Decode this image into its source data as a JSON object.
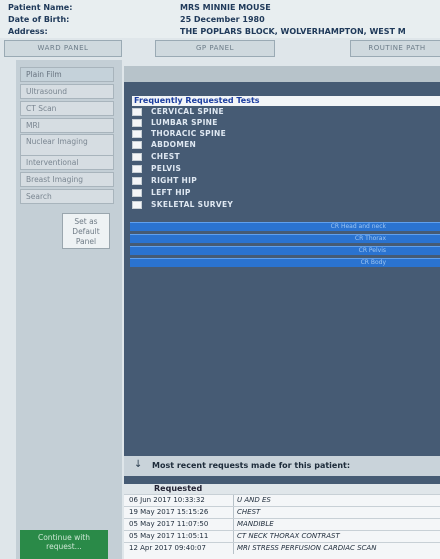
{
  "patient": {
    "name_label": "Patient Name:",
    "name": "MRS MINNIE MOUSE",
    "dob_label": "Date of Birth:",
    "dob": "25 December 1980",
    "address_label": "Address:",
    "address": "THE POPLARS BLOCK, WOLVERHAMPTON, WEST M"
  },
  "tabs": [
    "WARD PANEL",
    "GP PANEL",
    "ROUTINE PATH"
  ],
  "sidebar": {
    "items": [
      "Plain Film",
      "Ultrasound",
      "CT Scan",
      "MRI",
      "Nuclear Imaging",
      "Interventional",
      "Breast Imaging",
      "Search"
    ],
    "default_button": "Set as Default Panel",
    "continue_button": "Continue with request..."
  },
  "frequent": {
    "title": "Frequently Requested Tests",
    "tests": [
      "CERVICAL SPINE",
      "LUMBAR SPINE",
      "THORACIC SPINE",
      "ABDOMEN",
      "CHEST",
      "PELVIS",
      "RIGHT HIP",
      "LEFT HIP",
      "SKELETAL SURVEY"
    ]
  },
  "bars": [
    "CR Head and neck",
    "CR Thorax",
    "CR Pelvis",
    "CR Body"
  ],
  "recent": {
    "title": "Most recent requests made for this patient:",
    "column_header": "Requested",
    "rows": [
      {
        "date": "06 Jun 2017 10:33:32",
        "test": "U AND ES"
      },
      {
        "date": "19 May 2017 15:15:26",
        "test": "CHEST"
      },
      {
        "date": "05 May 2017 11:07:50",
        "test": "MANDIBLE"
      },
      {
        "date": "05 May 2017 11:05:11",
        "test": "CT NECK THORAX CONTRAST"
      },
      {
        "date": "12 Apr 2017 09:40:07",
        "test": "MRI STRESS PERFUSION CARDIAC SCAN"
      }
    ]
  }
}
